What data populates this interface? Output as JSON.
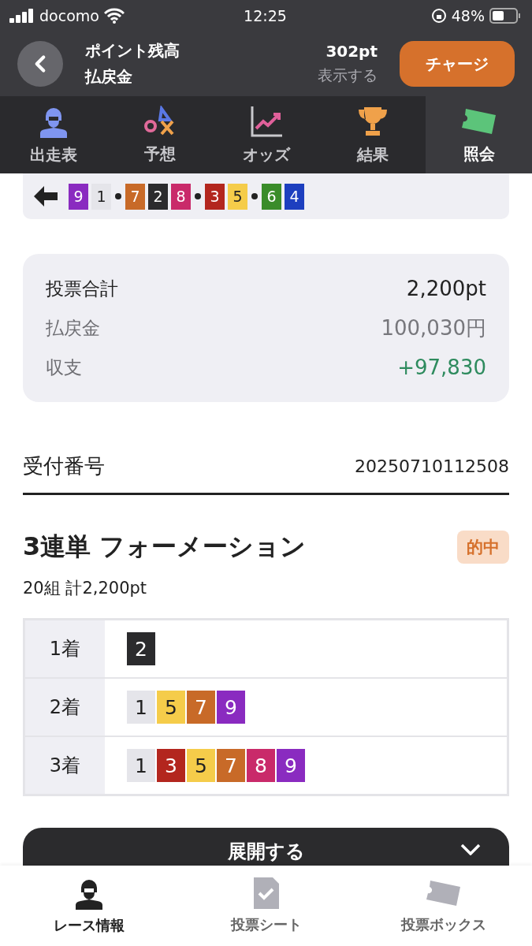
{
  "status_bar": {
    "carrier": "docomo",
    "time": "12:25",
    "battery": "48%"
  },
  "header": {
    "title_1": "ポイント残高",
    "title_2": "払戻金",
    "points": "302pt",
    "reveal": "表示する",
    "charge_button": "チャージ"
  },
  "tabs": [
    {
      "label": "出走表",
      "selected": false,
      "kind": "rider"
    },
    {
      "label": "予想",
      "selected": false,
      "kind": "symbols"
    },
    {
      "label": "オッズ",
      "selected": false,
      "kind": "chart"
    },
    {
      "label": "結果",
      "selected": false,
      "kind": "trophy"
    },
    {
      "label": "照会",
      "selected": true,
      "kind": "ticket"
    }
  ],
  "result_order": [
    [
      {
        "number": "9",
        "color": "#8a2bc0"
      },
      {
        "number": "1",
        "color": "#e5e5ea"
      }
    ],
    [
      {
        "number": "7",
        "color": "#c86a28"
      },
      {
        "number": "2",
        "color": "#2b2b2d"
      },
      {
        "number": "8",
        "color": "#c92a6a"
      }
    ],
    [
      {
        "number": "3",
        "color": "#b3261e"
      },
      {
        "number": "5",
        "color": "#f5cc4a"
      }
    ],
    [
      {
        "number": "6",
        "color": "#3a8c2a"
      },
      {
        "number": "4",
        "color": "#1d3fbf"
      }
    ]
  ],
  "summary": [
    {
      "label": "投票合計",
      "value": "2,200pt",
      "kind": "plain"
    },
    {
      "label": "払戻金",
      "value": "100,030円",
      "kind": "muted"
    },
    {
      "label": "収支",
      "value": "+97,830",
      "kind": "gain"
    }
  ],
  "receipt": {
    "label": "受付番号",
    "value": "20250710112508"
  },
  "bet": {
    "title": "3連単 フォーメーション",
    "badge": "的中",
    "subtitle": "20組 計2,200pt",
    "rows": [
      {
        "label": "1着",
        "numbers": [
          {
            "number": "2",
            "color": "#2b2b2d"
          }
        ]
      },
      {
        "label": "2着",
        "numbers": [
          {
            "number": "1",
            "color": "#e5e5ea"
          },
          {
            "number": "5",
            "color": "#f5cc4a"
          },
          {
            "number": "7",
            "color": "#c86a28"
          },
          {
            "number": "9",
            "color": "#8a2bc0"
          }
        ]
      },
      {
        "label": "3着",
        "numbers": [
          {
            "number": "1",
            "color": "#e5e5ea"
          },
          {
            "number": "3",
            "color": "#b3261e"
          },
          {
            "number": "5",
            "color": "#f5cc4a"
          },
          {
            "number": "7",
            "color": "#c86a28"
          },
          {
            "number": "8",
            "color": "#c92a6a"
          },
          {
            "number": "9",
            "color": "#8a2bc0"
          }
        ]
      }
    ]
  },
  "expand_button": "展開する",
  "bottom_nav": [
    {
      "label": "レース情報",
      "selected": true,
      "kind": "rider"
    },
    {
      "label": "投票シート",
      "selected": false,
      "kind": "sheet"
    },
    {
      "label": "投票ボックス",
      "selected": false,
      "kind": "ticket"
    }
  ]
}
